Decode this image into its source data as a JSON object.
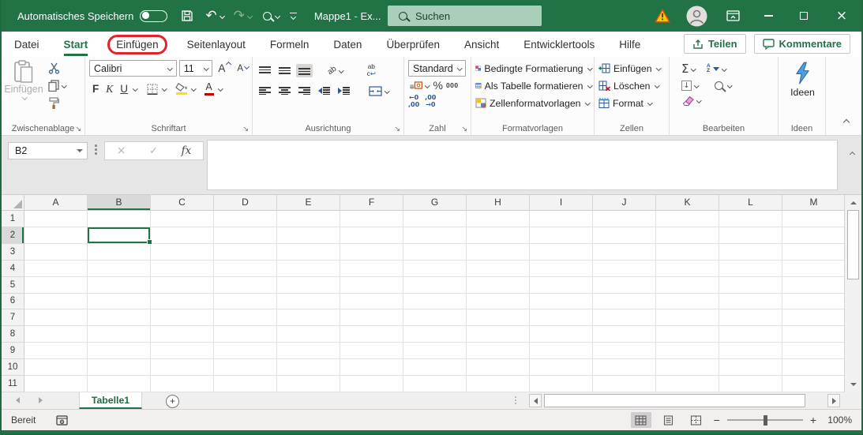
{
  "colors": {
    "excel_green": "#217346",
    "annotation_red": "#e0242c",
    "selection_green": "#217346",
    "titlebar_search_bg": "#a9cfba"
  },
  "titlebar": {
    "autosave_label": "Automatisches Speichern",
    "document_title": "Mappe1 - Ex...",
    "search_placeholder": "Suchen"
  },
  "tabs": {
    "items": [
      {
        "label": "Datei"
      },
      {
        "label": "Start",
        "active": true
      },
      {
        "label": "Einfügen",
        "annotated": true
      },
      {
        "label": "Seitenlayout"
      },
      {
        "label": "Formeln"
      },
      {
        "label": "Daten"
      },
      {
        "label": "Überprüfen"
      },
      {
        "label": "Ansicht"
      },
      {
        "label": "Entwicklertools"
      },
      {
        "label": "Hilfe"
      }
    ],
    "share_label": "Teilen",
    "comments_label": "Kommentare"
  },
  "ribbon": {
    "clipboard": {
      "group_label": "Zwischenablage",
      "paste_label": "Einfügen"
    },
    "font": {
      "group_label": "Schriftart",
      "font_name": "Calibri",
      "font_size": "11",
      "bold_glyph": "F",
      "italic_glyph": "K",
      "underline_glyph": "U",
      "grow_glyph": "A",
      "shrink_glyph": "A",
      "font_color_glyph": "A"
    },
    "alignment": {
      "group_label": "Ausrichtung",
      "orientation_glyph": "ab",
      "wrap_glyph_top": "ab",
      "wrap_glyph_bottom": "c",
      "wrap_return_glyph": "↩"
    },
    "number": {
      "group_label": "Zahl",
      "format_value": "Standard",
      "percent_glyph": "%",
      "thousands_glyph": "000",
      "inc_dec_top": "←0",
      "inc_dec_bottom": ",00",
      "dec_dec_top": ",00",
      "dec_dec_bottom": "→0"
    },
    "styles": {
      "group_label": "Formatvorlagen",
      "conditional_label": "Bedingte Formatierung",
      "as_table_label": "Als Tabelle formatieren",
      "cell_styles_label": "Zellenformatvorlagen"
    },
    "cells": {
      "group_label": "Zellen",
      "insert_label": "Einfügen",
      "delete_label": "Löschen",
      "format_label": "Format"
    },
    "editing": {
      "group_label": "Bearbeiten",
      "autosum_glyph": "Σ",
      "sort_a": "A",
      "sort_z": "Z",
      "fill_glyph": "↓"
    },
    "ideas": {
      "group_label": "Ideen",
      "button_label": "Ideen"
    }
  },
  "formula_bar": {
    "name_box_value": "B2",
    "fx_label": "fx",
    "formula_value": ""
  },
  "grid": {
    "columns": [
      "A",
      "B",
      "C",
      "D",
      "E",
      "F",
      "G",
      "H",
      "I",
      "J",
      "K",
      "L",
      "M"
    ],
    "rows": [
      1,
      2,
      3,
      4,
      5,
      6,
      7,
      8,
      9,
      10,
      11
    ],
    "selected_cell": "B2",
    "selected_column": "B",
    "selected_row": 2,
    "cells": {}
  },
  "sheet_bar": {
    "sheet_name": "Tabelle1"
  },
  "status_bar": {
    "status_label": "Bereit",
    "zoom_level": "100%"
  }
}
